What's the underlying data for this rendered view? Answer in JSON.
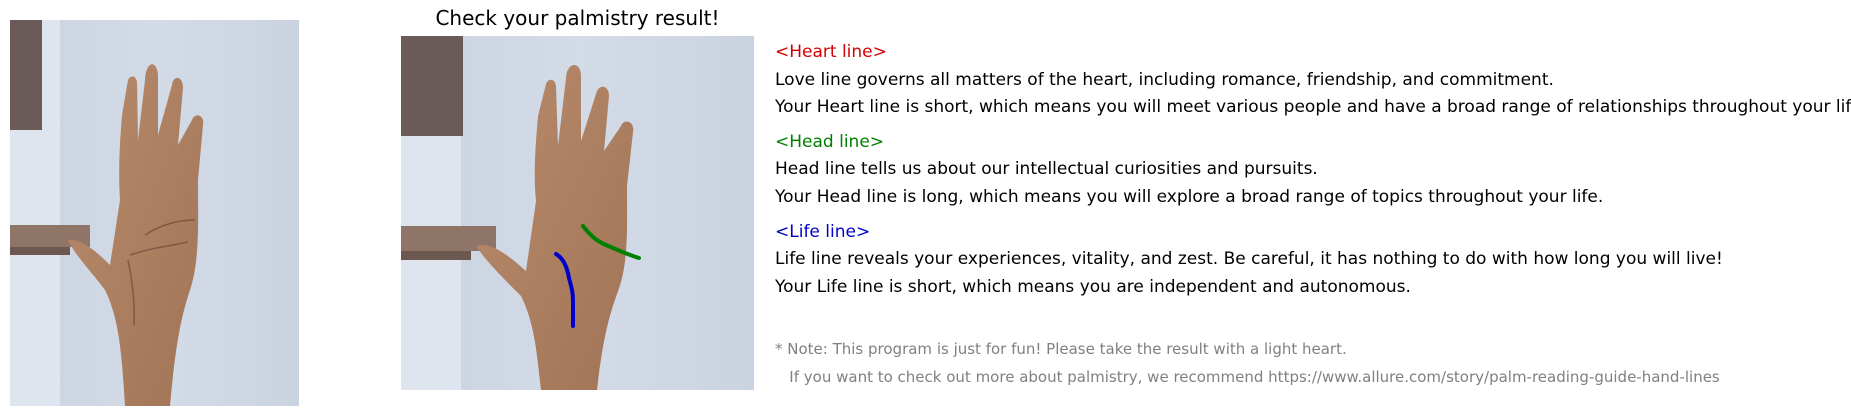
{
  "title": "Check your palmistry result!",
  "colors": {
    "heart": "#d40000",
    "head": "#008000",
    "life": "#0000cc",
    "note": "#808080"
  },
  "sections": {
    "heart": {
      "header": "<Heart line>",
      "description": "Love line governs all matters of the heart, including romance, friendship, and commitment.",
      "result": "Your Heart line is short, which means you will meet various people and have a broad range of relationships throughout your life."
    },
    "head": {
      "header": "<Head line>",
      "description": "Head line tells us about our intellectual curiosities and pursuits.",
      "result": "Your Head line is long, which means you will explore a broad range of topics throughout your life."
    },
    "life": {
      "header": "<Life line>",
      "description": "Life line reveals your experiences, vitality, and zest. Be careful, it has nothing to do with how long you will live!",
      "result": "Your Life line is short, which means you are independent and autonomous."
    }
  },
  "note": {
    "line1": "* Note: This program is just for fun! Please take the result with a light heart.",
    "line2": "   If you want to check out more about palmistry, we recommend https://www.allure.com/story/palm-reading-guide-hand-lines"
  }
}
